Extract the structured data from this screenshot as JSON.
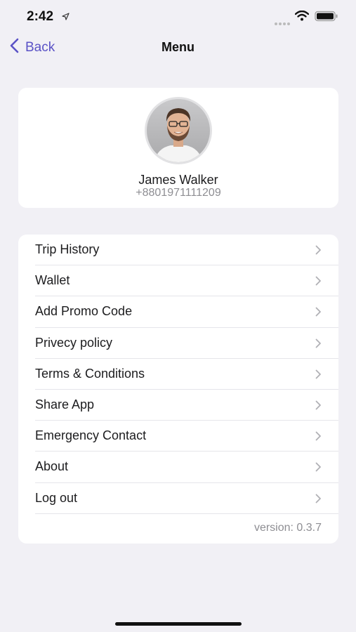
{
  "status_bar": {
    "time": "2:42"
  },
  "nav": {
    "back_label": "Back",
    "title": "Menu"
  },
  "profile": {
    "name": "James Walker",
    "phone": "+8801971111209"
  },
  "menu": {
    "items": [
      {
        "label": "Trip History"
      },
      {
        "label": "Wallet"
      },
      {
        "label": "Add Promo Code"
      },
      {
        "label": "Privecy policy"
      },
      {
        "label": "Terms & Conditions"
      },
      {
        "label": "Share App"
      },
      {
        "label": "Emergency Contact"
      },
      {
        "label": "About"
      },
      {
        "label": "Log out"
      }
    ],
    "version": "version: 0.3.7"
  },
  "colors": {
    "accent": "#5a52c6",
    "background": "#f1f0f5",
    "secondary_text": "#8e8e93"
  }
}
